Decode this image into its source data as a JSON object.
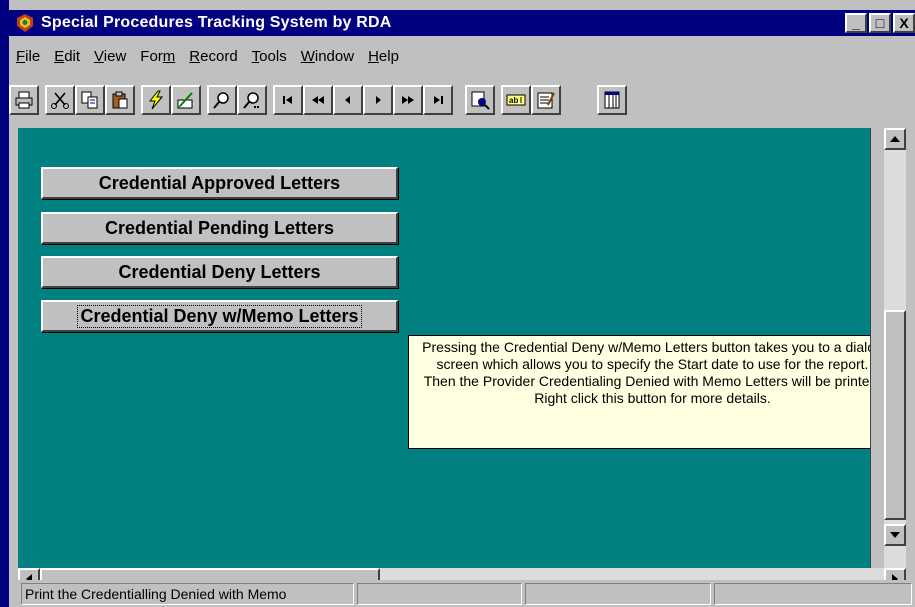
{
  "window": {
    "title": "Special Procedures Tracking System by RDA",
    "minimize_glyph": "_",
    "restore_glyph": "□",
    "close_glyph": "X"
  },
  "menu": [
    {
      "label": "File",
      "ul": "F",
      "rest": "ile"
    },
    {
      "label": "Edit",
      "ul": "E",
      "rest": "dit"
    },
    {
      "label": "View",
      "ul": "V",
      "rest": "iew"
    },
    {
      "label": "Form",
      "pre": "For",
      "ul": "m",
      "rest": ""
    },
    {
      "label": "Record",
      "ul": "R",
      "rest": "ecord"
    },
    {
      "label": "Tools",
      "ul": "T",
      "rest": "ools"
    },
    {
      "label": "Window",
      "ul": "W",
      "rest": "indow"
    },
    {
      "label": "Help",
      "ul": "H",
      "rest": "elp"
    }
  ],
  "toolbar_icons": [
    "print-icon",
    "cut-icon",
    "copy-icon",
    "paste-icon",
    "lightning-icon",
    "design-icon",
    "find-icon",
    "find-next-icon",
    "first-record-icon",
    "rewind-icon",
    "previous-record-icon",
    "next-record-icon",
    "fast-forward-icon",
    "last-record-icon",
    "binoculars-icon",
    "field-list-icon",
    "properties-icon",
    "database-window-icon"
  ],
  "buttons": {
    "approved": "Credential Approved Letters",
    "pending": "Credential Pending Letters",
    "deny": "Credential Deny Letters",
    "deny_memo": "Credential Deny w/Memo Letters"
  },
  "tooltip": "Pressing the Credential Deny w/Memo Letters button takes you to a dialog screen which allows you to specify the Start date to use for the report. Then the Provider Credentialing Denied with Memo Letters will be printed. Right click this button for more details.",
  "status": {
    "message": "Print the Credentialling Denied with Memo",
    "panel2": "",
    "panel3": "",
    "panel4": ""
  },
  "colors": {
    "title_bar": "#000080",
    "form_background": "#008080",
    "tooltip_background": "#ffffe1"
  }
}
